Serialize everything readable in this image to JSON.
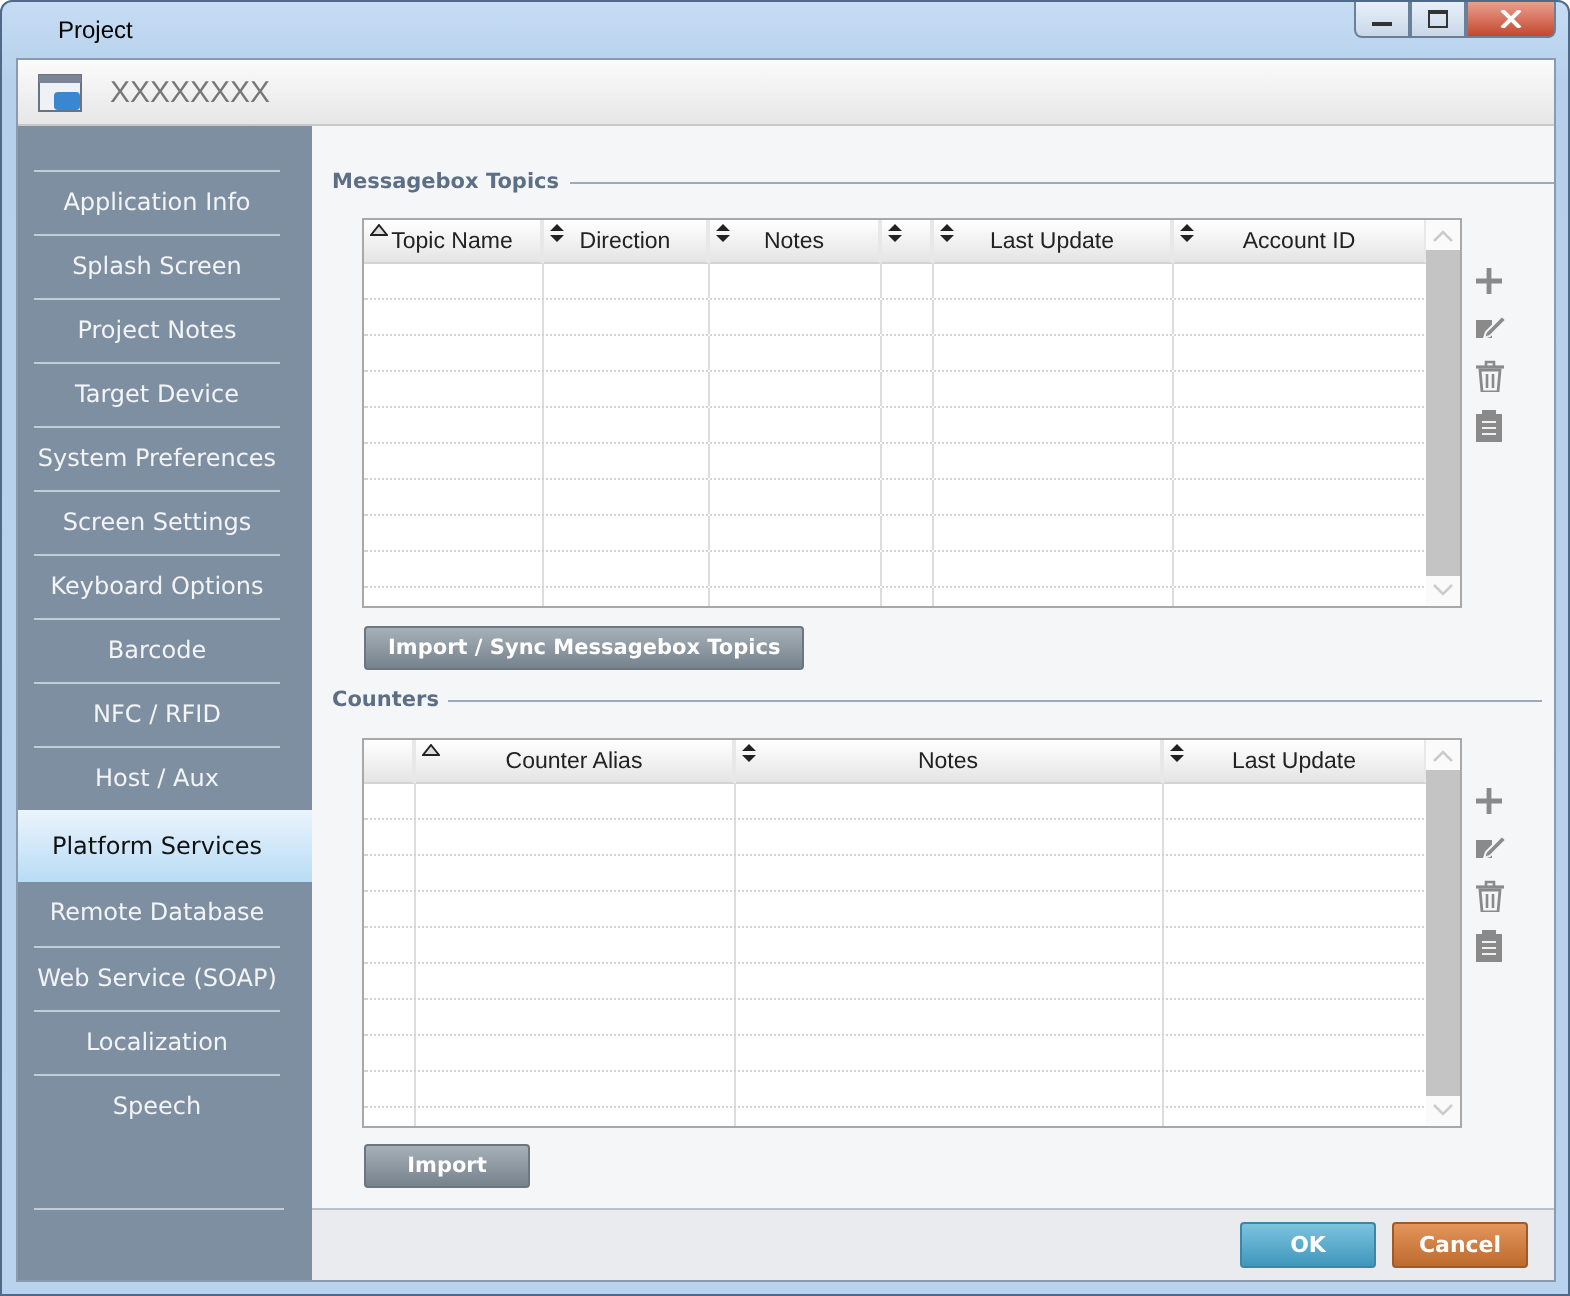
{
  "window": {
    "title": "Project"
  },
  "header": {
    "title": "XXXXXXXX"
  },
  "sidebar": {
    "items": [
      {
        "label": "Application Info",
        "selected": false
      },
      {
        "label": "Splash Screen",
        "selected": false
      },
      {
        "label": "Project Notes",
        "selected": false
      },
      {
        "label": "Target Device",
        "selected": false
      },
      {
        "label": "System Preferences",
        "selected": false
      },
      {
        "label": "Screen Settings",
        "selected": false
      },
      {
        "label": "Keyboard Options",
        "selected": false
      },
      {
        "label": "Barcode",
        "selected": false
      },
      {
        "label": "NFC / RFID",
        "selected": false
      },
      {
        "label": "Host / Aux",
        "selected": false
      },
      {
        "label": "Platform Services",
        "selected": true
      },
      {
        "label": "Remote Database",
        "selected": false
      },
      {
        "label": "Web Service (SOAP)",
        "selected": false
      },
      {
        "label": "Localization",
        "selected": false
      },
      {
        "label": "Speech",
        "selected": false
      }
    ]
  },
  "sections": [
    {
      "title": "Messagebox Topics",
      "columns": [
        {
          "label": "Topic Name",
          "sorted": true
        },
        {
          "label": "Direction",
          "sorted": false
        },
        {
          "label": "Notes",
          "sorted": false
        },
        {
          "sorted": false
        },
        {
          "label": "Last Update",
          "sorted": false
        },
        {
          "label": "Account ID",
          "sorted": false
        }
      ],
      "button": "Import / Sync Messagebox Topics"
    },
    {
      "title": "Counters",
      "columns": [
        {
          "sortable": false
        },
        {
          "label": "Counter Alias",
          "sorted": true
        },
        {
          "label": "Notes",
          "sorted": false
        },
        {
          "label": "Last Update",
          "sorted": false
        }
      ],
      "button": "Import"
    }
  ],
  "buttons": [
    {
      "label": "OK",
      "kind": "primary"
    },
    {
      "label": "Cancel",
      "kind": "cancel"
    }
  ]
}
